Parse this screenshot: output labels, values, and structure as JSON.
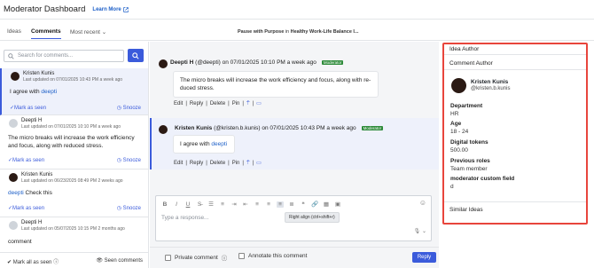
{
  "header": {
    "title": "Moderator Dashboard",
    "learn_more": "Learn More"
  },
  "subnav": {
    "tabs": [
      "Ideas",
      "Comments",
      "Most recent"
    ],
    "thread_prefix": "Pause with Purpose",
    "thread_in": " in ",
    "thread_name": "Healthy Work-Life Balance I..."
  },
  "left": {
    "search_placeholder": "Search for comments...",
    "items": [
      {
        "name": "Kristen Kunis",
        "time": "Last updated on 07/01/2025 10:43 PM a week ago",
        "body_prefix": "I agree with ",
        "mention": "deepti",
        "mark": "Mark as seen",
        "snooze": "Snooze"
      },
      {
        "name": "Deepti H",
        "time": "Last updated on 07/01/2025 10:10 PM a week ago",
        "body": "The micro breaks will increase the work efficiency and focus, along with reduced stress.",
        "mark": "Mark as seen",
        "snooze": "Snooze"
      },
      {
        "name": "Kristen Kunis",
        "time": "Last updated on 06/23/2025 08:49 PM 2 weeks ago",
        "mention": "deepti",
        "body_suffix": " Check this",
        "mark": "Mark as seen",
        "snooze": "Snooze"
      },
      {
        "name": "Deepti H",
        "time": "Last updated on 05/07/2025 10:15 PM 2 months ago",
        "body": "comment"
      }
    ],
    "mark_all": "Mark all as seen",
    "seen": "Seen comments"
  },
  "center": {
    "messages": [
      {
        "author": "Deepti H",
        "handle": " (@deepti) on 07/01/2025 10:10 PM a week ago",
        "badge": "Moderator",
        "body": "The micro breaks will increase the work efficiency and focus, along with re-duced stress.",
        "actions": [
          "Edit",
          "|",
          "Reply",
          "|",
          "Delete",
          "|",
          "Pin",
          "|"
        ]
      },
      {
        "author": "Kristen Kunis",
        "handle": " (@kristen.b.kunis) on 07/01/2025 10:43 PM a week ago",
        "badge": "Moderator",
        "body_prefix": "I agree with ",
        "mention": "deepti",
        "actions": [
          "Edit",
          "|",
          "Reply",
          "|",
          "Delete",
          "|",
          "Pin",
          "|"
        ]
      }
    ],
    "composer_placeholder": "Type a response...",
    "tooltip": "Right align (ctrl+shift+r)",
    "private": "Private comment",
    "annotate": "Annotate this comment",
    "reply": "Reply"
  },
  "right": {
    "idea_author": "Idea Author",
    "comment_author": "Comment Author",
    "profile": {
      "name": "Kristen Kunis",
      "handle": "@kristen.b.kunis"
    },
    "fields": [
      {
        "label": "Department",
        "value": "HR"
      },
      {
        "label": "Age",
        "value": "18 - 24"
      },
      {
        "label": "Digital tokens",
        "value": "500.00"
      },
      {
        "label": "Previous roles",
        "value": "Team member"
      },
      {
        "label": "moderator custom field",
        "value": "d"
      }
    ],
    "similar": "Similar Ideas"
  },
  "colors": {
    "accent": "#3b5bdb",
    "moderator_badge": "#2e8b3a",
    "highlight_border": "#e8453c"
  }
}
